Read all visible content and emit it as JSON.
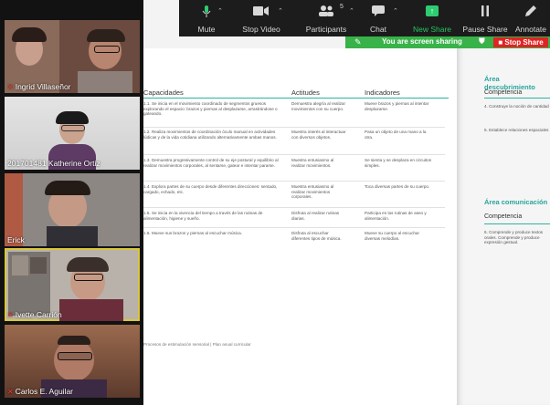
{
  "toolbar": {
    "mute_label": "Mute",
    "stop_video_label": "Stop Video",
    "participants_label": "Participants",
    "participants_count": "5",
    "chat_label": "Chat",
    "new_share_label": "New Share",
    "pause_share_label": "Pause Share",
    "annotate_label": "Annotate"
  },
  "banner": {
    "sharing_text": "You are screen sharing",
    "stop_share_label": "Stop Share",
    "color": "#38b249",
    "stop_color": "#e02424"
  },
  "participants": [
    {
      "name": "Ingrid Villaseñor"
    },
    {
      "name": "201701481 Katherine Ortiz"
    },
    {
      "name": "Erick"
    },
    {
      "name": "Ivette Carrión"
    },
    {
      "name": "Carlos E. Aguilar"
    }
  ],
  "document": {
    "headers": {
      "capacidades": "Capacidades",
      "actitudes": "Actitudes",
      "indicadores": "Indicadores"
    },
    "rows": [
      {
        "capacidad": "1.1. Se inicia en el movimiento coordinado de segmentos gruesos explorando el espacio: brazos y piernas al desplazarse, arrastrándose o gateando.",
        "actitud": "Demuestra alegría al realizar movimientos con su cuerpo.",
        "indicador": "Mueve brazos y piernas al intentar desplazarse."
      },
      {
        "capacidad": "1.2. Realiza movimientos de coordinación óculo manual en actividades lúdicas y de la vida cotidiana utilizando alternativamente ambas manos.",
        "actitud": "Muestra interés al interactuar con diversos objetos.",
        "indicador": "Pasa un objeto de una mano a la otra."
      },
      {
        "capacidad": "1.3. Demuestra progresivamente control de su eje postural y equilibrio al realizar movimientos corporales, al sentarse, gatear e intentar pararse.",
        "actitud": "Muestra entusiasmo al realizar movimientos.",
        "indicador": "Se sienta y se desplaza en circuitos simples."
      },
      {
        "capacidad": "1.4. Explora partes de su cuerpo desde diferentes direcciones: sentado, cargado, echado, etc.",
        "actitud": "Muestra entusiasmo al realizar movimientos corporales.",
        "indicador": "Toca diversas partes de su cuerpo."
      },
      {
        "capacidad": "1.5. Se inicia en la vivencia del tiempo a través de las rutinas de alimentación, higiene y sueño.",
        "actitud": "Disfruta al realizar rutinas diarias.",
        "indicador": "Participa en las rutinas de aseo y alimentación."
      },
      {
        "capacidad": "1.6. Mueve sus brazos y piernas al escuchar música.",
        "actitud": "Disfruta al escuchar diferentes tipos de música.",
        "indicador": "Mueve su cuerpo al escuchar diversas melodías."
      }
    ],
    "footer": "Procesos de estimulación sensorial   |   Plan anual curricular",
    "side": {
      "area1_title": "Área descubrimiento",
      "area1_comp": "Competencia",
      "area1_items": [
        "4. Construye la noción de cantidad",
        "5. Establece relaciones espaciales"
      ],
      "area2_title": "Área comunicación",
      "area2_comp": "Competencia",
      "area2_items": [
        "6. Comprende y produce textos orales. Comprende y produce expresión gestual."
      ]
    }
  },
  "accent_color": "#2bb3a3"
}
